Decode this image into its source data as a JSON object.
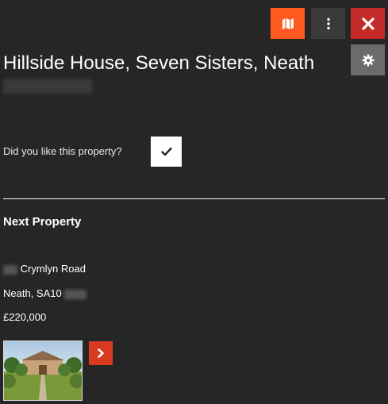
{
  "toolbar": {
    "map_icon": "map-icon",
    "more_icon": "vertical-dots-icon",
    "close_icon": "close-icon",
    "settings_icon": "gear-icon",
    "colors": {
      "map": "#ff5a1f",
      "more": "#3a3a3a",
      "close": "#c52a2a",
      "settings": "#6b6b6b"
    }
  },
  "property": {
    "title": "Hillside House, Seven Sisters, Neath"
  },
  "feedback": {
    "question": "Did you like this property?",
    "check_icon": "checkmark-icon"
  },
  "next": {
    "heading": "Next Property",
    "street": "Crymlyn Road",
    "town_postcode": "Neath, SA10",
    "price": "£220,000",
    "thumb_alt": "property-photo",
    "next_icon": "chevron-right-icon"
  }
}
